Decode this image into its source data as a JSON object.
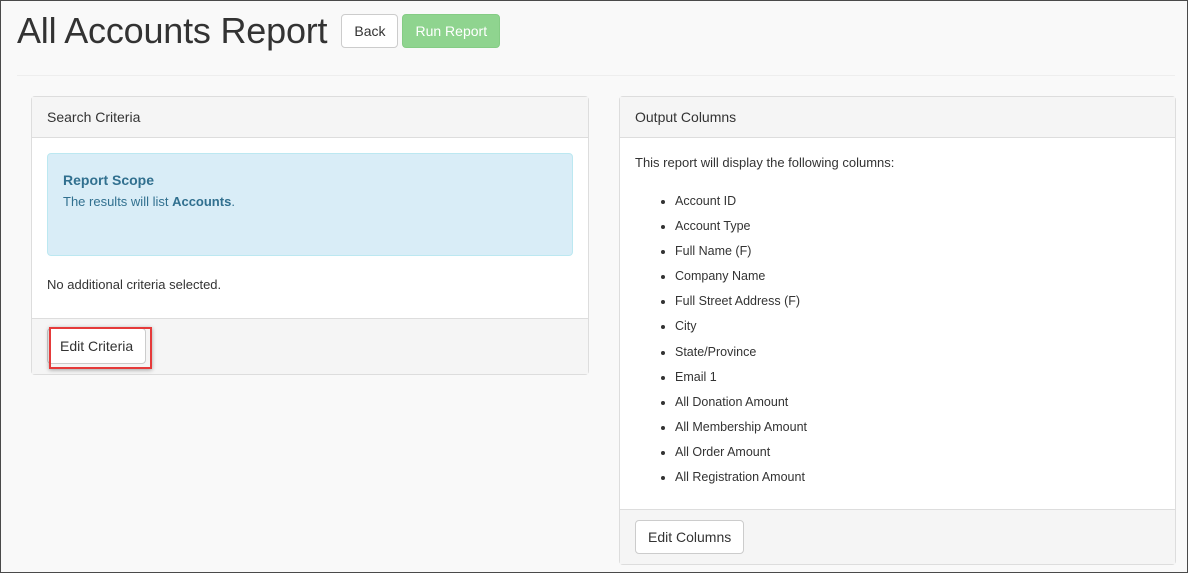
{
  "header": {
    "title": "All Accounts Report",
    "back_label": "Back",
    "run_label": "Run Report"
  },
  "search_criteria": {
    "heading": "Search Criteria",
    "scope_title": "Report Scope",
    "scope_text_prefix": "The results will list ",
    "scope_entity": "Accounts",
    "scope_text_suffix": ".",
    "no_criteria_text": "No additional criteria selected.",
    "edit_label": "Edit Criteria"
  },
  "output_columns": {
    "heading": "Output Columns",
    "intro": "This report will display the following columns:",
    "columns": [
      "Account ID",
      "Account Type",
      "Full Name (F)",
      "Company Name",
      "Full Street Address (F)",
      "City",
      "State/Province",
      "Email 1",
      "All Donation Amount",
      "All Membership Amount",
      "All Order Amount",
      "All Registration Amount"
    ],
    "edit_label": "Edit Columns"
  },
  "colors": {
    "highlight": "#e53a3a",
    "run_button": "#8fd48f",
    "scope_background": "#d9edf7",
    "scope_text": "#31708f"
  }
}
